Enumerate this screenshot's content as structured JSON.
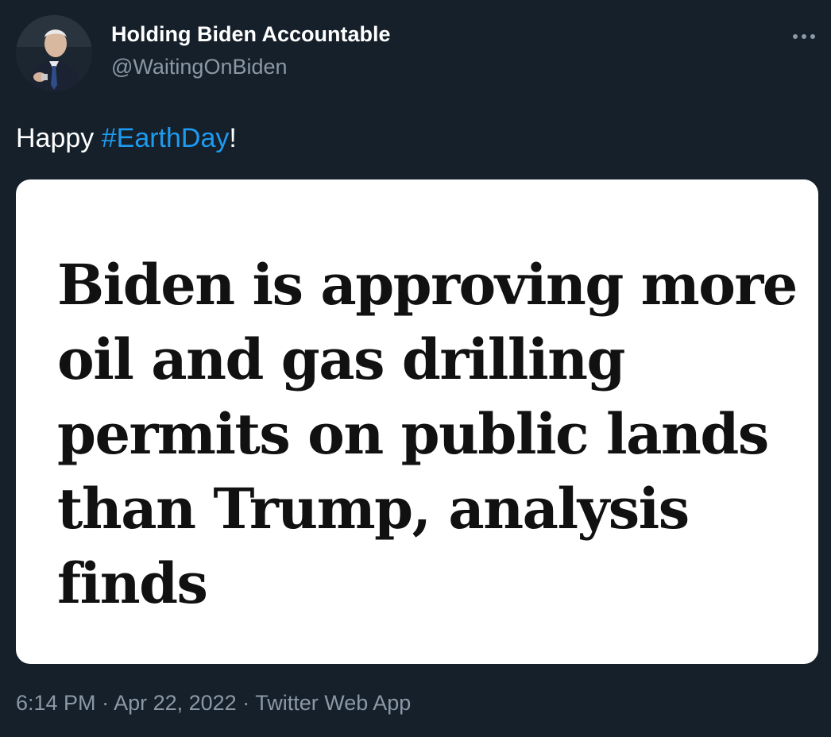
{
  "author": {
    "name": "Holding Biden Accountable",
    "handle": "@WaitingOnBiden",
    "avatar_icon": "profile-photo"
  },
  "more_icon": "more-horizontal-icon",
  "tweet": {
    "text_before": "Happy ",
    "hashtag": "#EarthDay",
    "text_after": "!"
  },
  "media": {
    "headline_lines": [
      "Biden is approving more",
      "oil and gas drilling",
      "permits on public lands",
      "than Trump, analysis",
      "finds"
    ]
  },
  "meta": {
    "time": "6:14 PM",
    "separator": " · ",
    "date": "Apr 22, 2022",
    "source": "Twitter Web App"
  },
  "colors": {
    "background": "#15202b",
    "link": "#1d9bf0",
    "secondary_text": "#8b98a5"
  }
}
